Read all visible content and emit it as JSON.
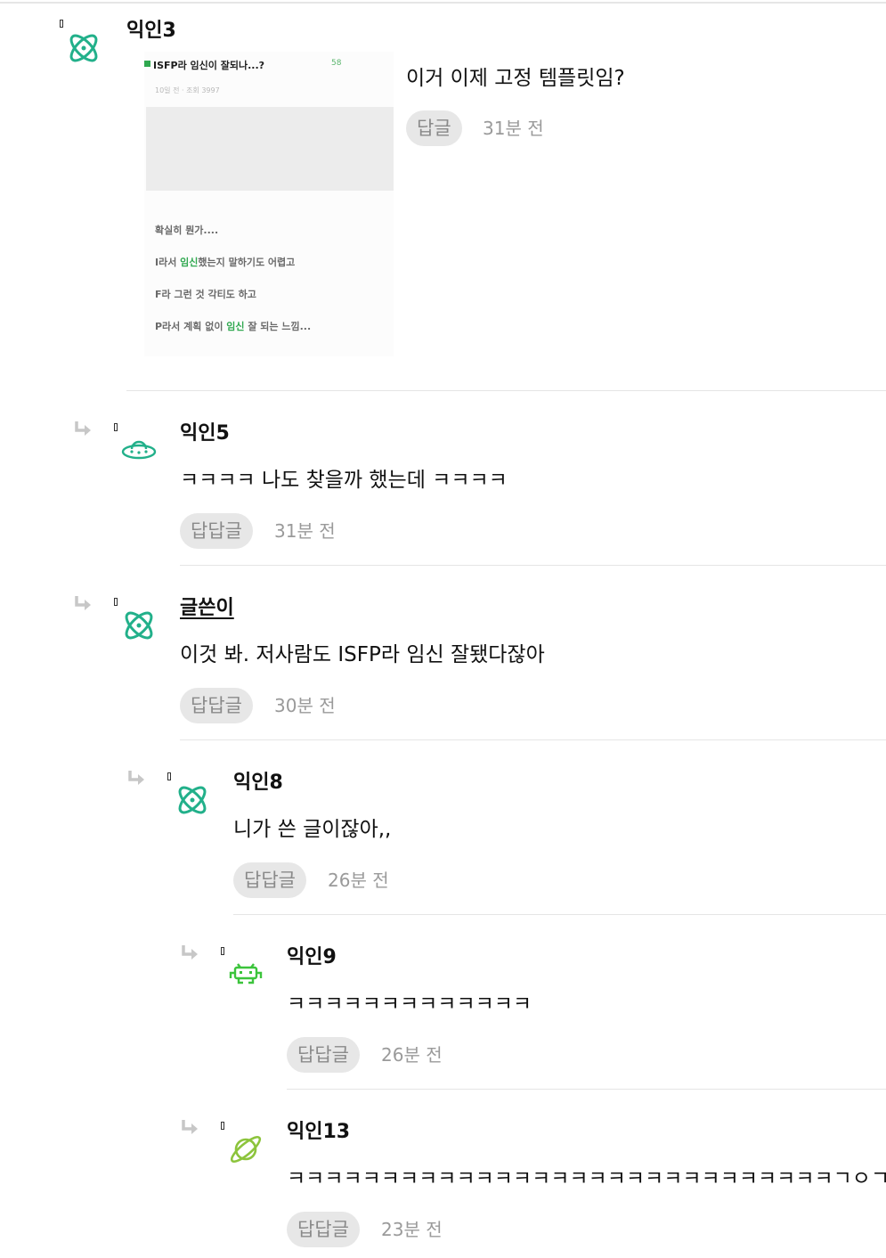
{
  "comments": [
    {
      "nickname": "익인3",
      "avatar": "atom-icon",
      "attachment": {
        "title": "ISFP라 임신이 잘되나...?",
        "count": "58",
        "meta": "10일 전 · 조회 3997",
        "lines": [
          {
            "before": "확실히 뭔가....",
            "highlight": "",
            "after": ""
          },
          {
            "before": "I라서 ",
            "highlight": "임신",
            "after": "했는지 말하기도 어렵고"
          },
          {
            "before": "F라 그런 것 각티도 하고",
            "highlight": "",
            "after": ""
          },
          {
            "before": "P라서 계획 없이 ",
            "highlight": "임신",
            "after": " 잘 되는 느낌..."
          }
        ]
      },
      "text": "이거 이제 고정 템플릿임?",
      "reply_label": "답글",
      "time": "31분 전"
    },
    {
      "nickname": "익인5",
      "avatar": "ufo-icon",
      "text": "ㅋㅋㅋㅋ 나도 찾을까 했는데 ㅋㅋㅋㅋ",
      "reply_label": "답답글",
      "time": "31분 전"
    },
    {
      "nickname": "글쓴이",
      "avatar": "atom-icon",
      "text": "이것 봐. 저사람도 ISFP라 임신 잘됐다잖아",
      "reply_label": "답답글",
      "time": "30분 전"
    },
    {
      "nickname": "익인8",
      "avatar": "atom-icon",
      "text": "니가 쓴 글이잖아,,",
      "reply_label": "답답글",
      "time": "26분 전"
    },
    {
      "nickname": "익인9",
      "avatar": "space-invader-icon",
      "text": "ㅋㅋㅋㅋㅋㅋㅋㅋㅋㅋㅋㅋㅋ",
      "reply_label": "답답글",
      "time": "26분 전"
    },
    {
      "nickname": "익인13",
      "avatar": "planet-icon",
      "text": "ㅋㅋㅋㅋㅋㅋㅋㅋㅋㅋㅋㅋㅋㅋㅋㅋㅋㅋㅋㅋㅋㅋㅋㅋㅋㅋㅋㅋㅋㄱㅇㄱ",
      "reply_label": "답답글",
      "time": "23분 전"
    }
  ],
  "colors": {
    "accent_green": "#22b08a",
    "invader_green": "#3cc43c",
    "planet_green": "#8cc43c",
    "button_bg": "#e7e7e7",
    "time_gray": "#9a9a9a"
  }
}
